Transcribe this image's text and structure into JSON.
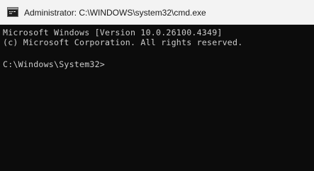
{
  "window": {
    "title": "Administrator: C:\\WINDOWS\\system32\\cmd.exe",
    "icon": "cmd-icon"
  },
  "console": {
    "lines": [
      "Microsoft Windows [Version 10.0.26100.4349]",
      "(c) Microsoft Corporation. All rights reserved.",
      "",
      "C:\\Windows\\System32>"
    ]
  },
  "colors": {
    "titlebar_bg": "#f3f3f3",
    "console_bg": "#0c0c0c",
    "console_fg": "#cccccc"
  }
}
